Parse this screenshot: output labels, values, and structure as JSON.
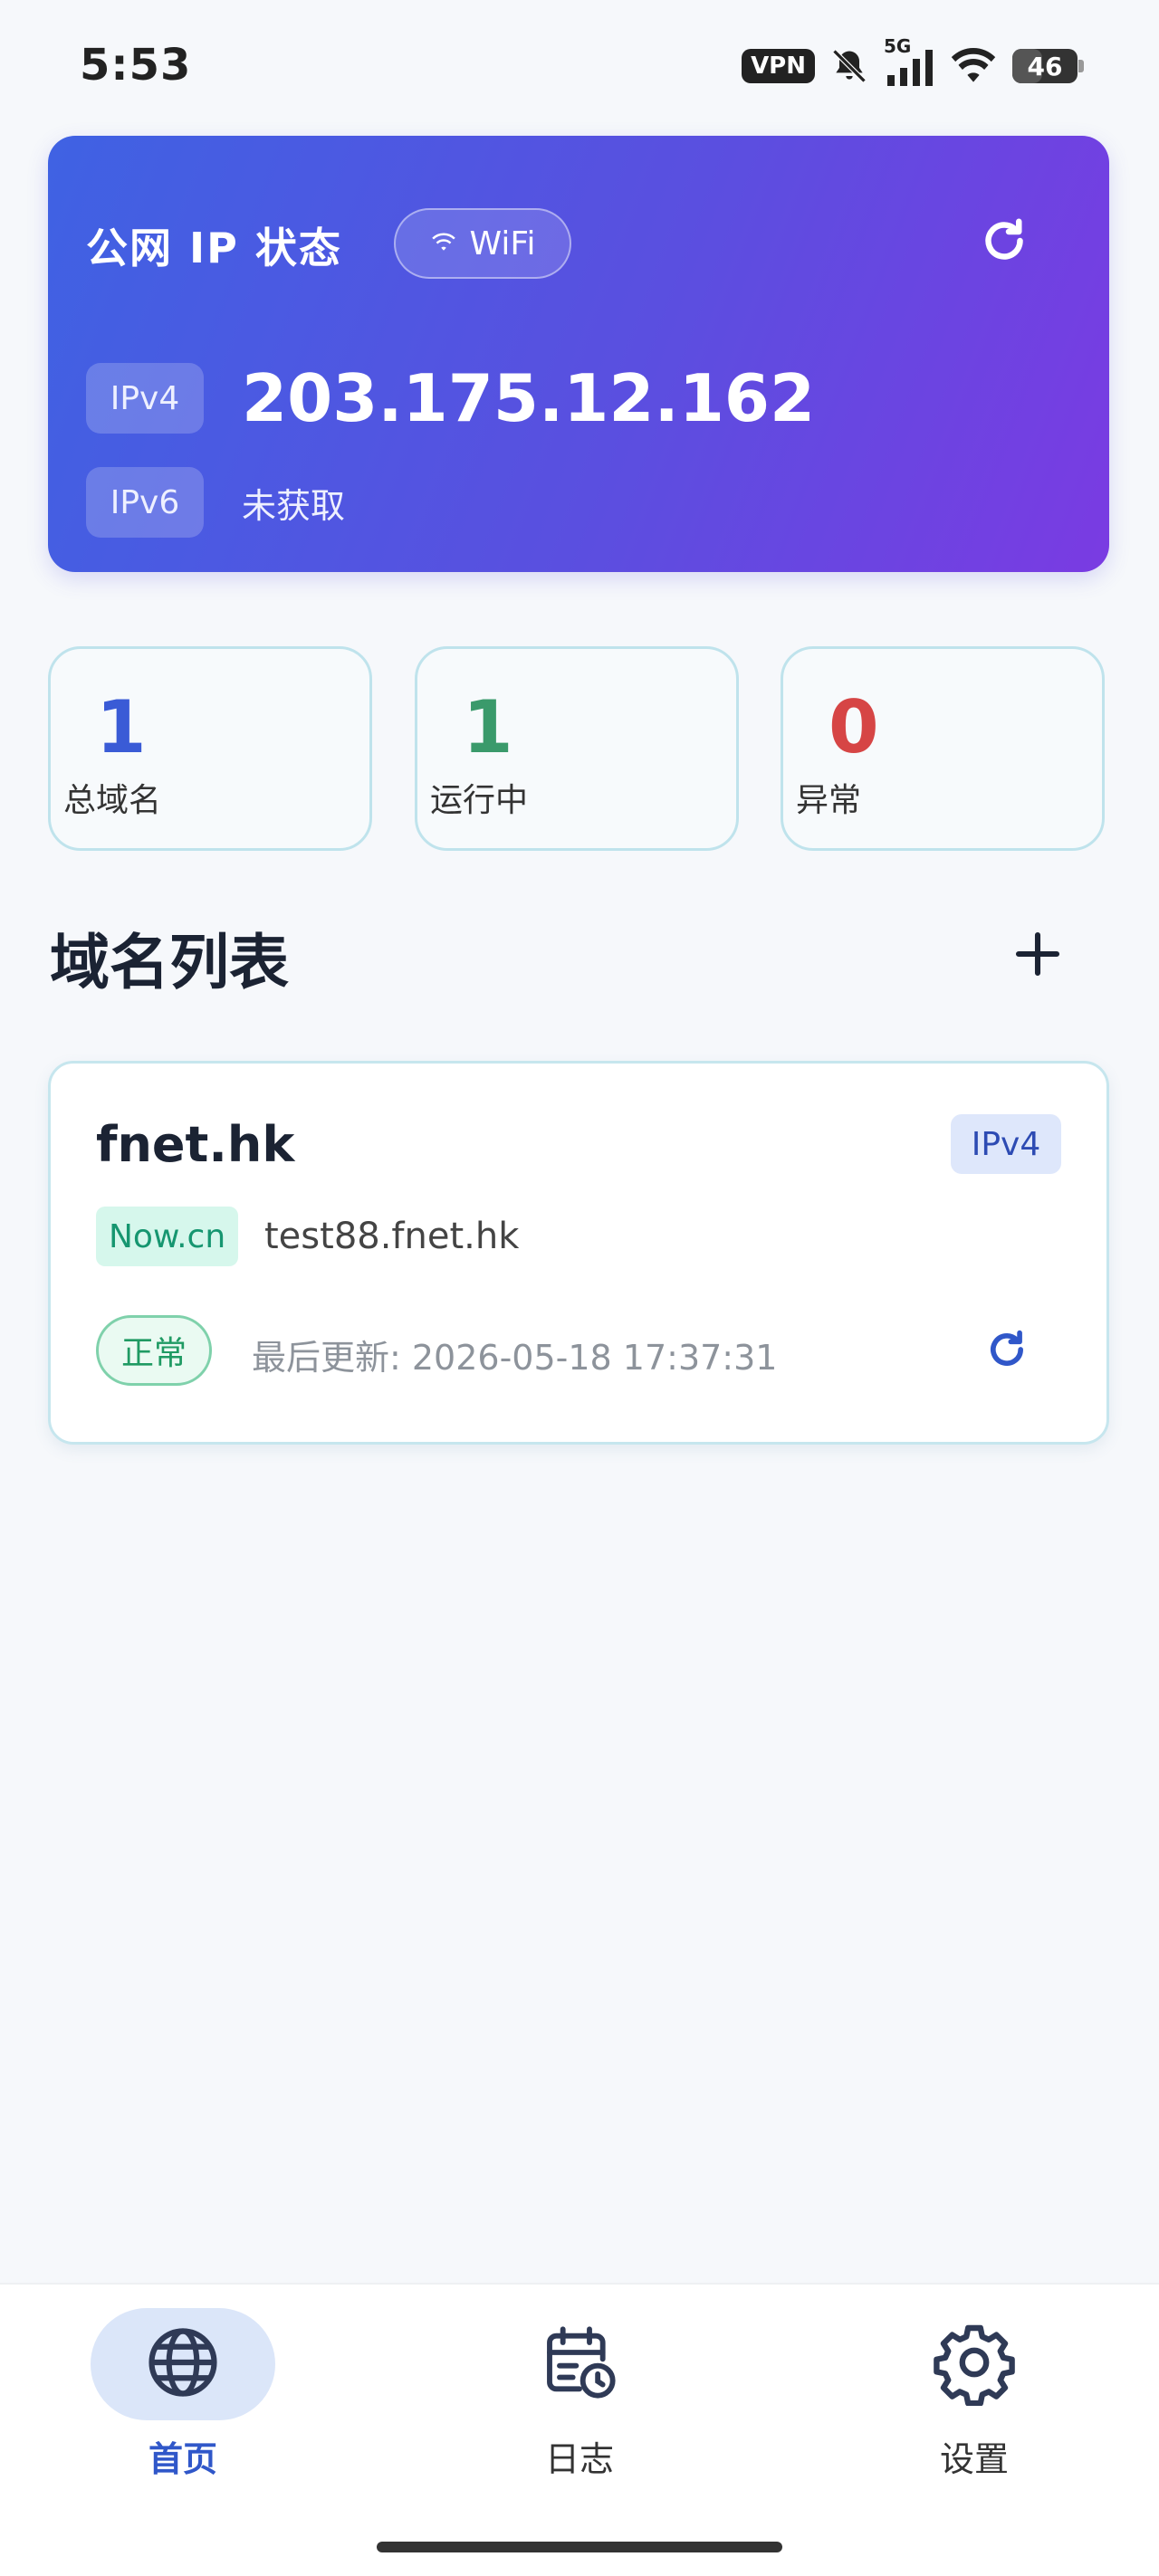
{
  "status_bar": {
    "time": "5:53",
    "vpn": "VPN",
    "network": "5G",
    "battery": "46",
    "battery_level": 0.46
  },
  "ip_card": {
    "title": "公网 IP 状态",
    "connection": "WiFi",
    "ipv4_label": "IPv4",
    "ipv4_value": "203.175.12.162",
    "ipv6_label": "IPv6",
    "ipv6_value": "未获取",
    "refresh_icon": "refresh-icon"
  },
  "stats": [
    {
      "value": "1",
      "label": "总域名",
      "color": "#3a5bd6"
    },
    {
      "value": "1",
      "label": "运行中",
      "color": "#3a9a6b"
    },
    {
      "value": "0",
      "label": "异常",
      "color": "#d64545"
    }
  ],
  "section": {
    "title": "域名列表",
    "add_icon": "plus-icon"
  },
  "domains": [
    {
      "name": "fnet.hk",
      "type": "IPv4",
      "provider": "Now.cn",
      "host": "test88.fnet.hk",
      "status": "正常",
      "updated": "最后更新: 2026-05-18 17:37:31"
    }
  ],
  "nav": {
    "items": [
      {
        "label": "首页",
        "icon": "globe-icon",
        "active": true
      },
      {
        "label": "日志",
        "icon": "calendar-clock-icon",
        "active": false
      },
      {
        "label": "设置",
        "icon": "gear-icon",
        "active": false
      }
    ]
  },
  "colors": {
    "accent": "#3057c9",
    "card_gradient_start": "#3f62e3",
    "card_gradient_end": "#7a3be2",
    "success": "#1f9a63"
  }
}
